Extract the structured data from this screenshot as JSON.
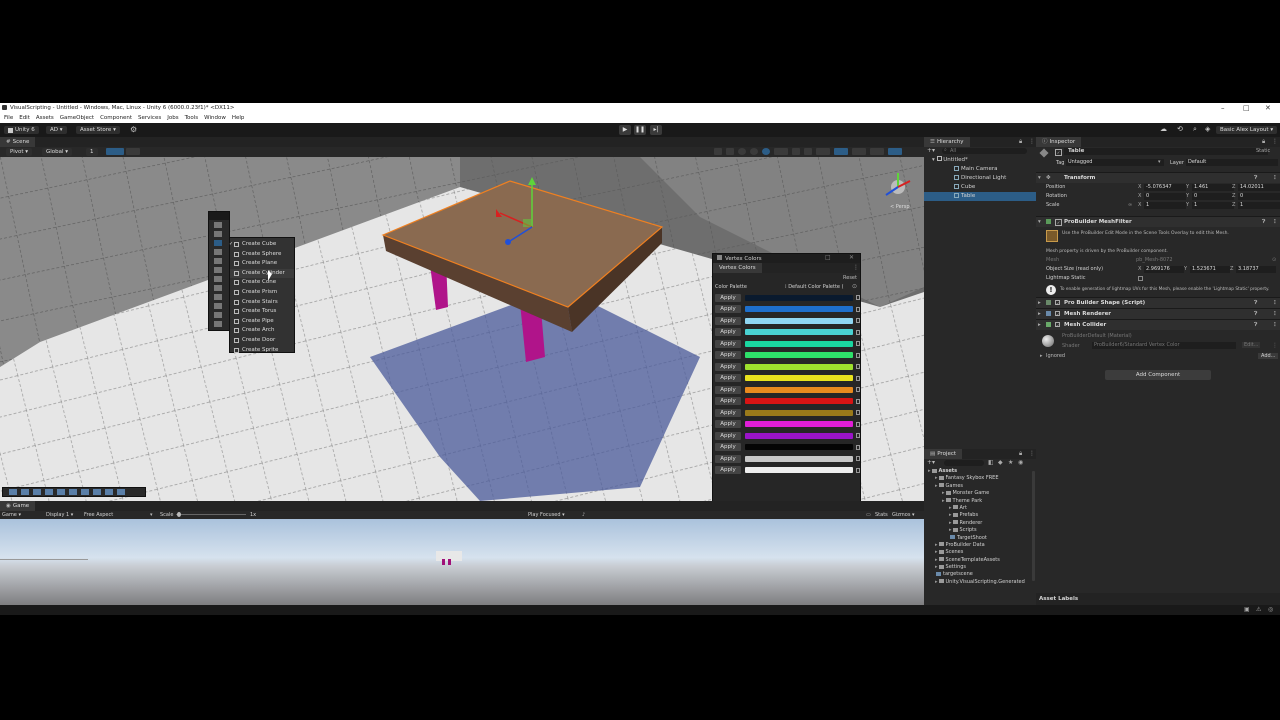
{
  "window": {
    "title": "VisualScripting - Untitled - Windows, Mac, Linux - Unity 6 (6000.0.23f1)* <DX11>",
    "menu": [
      "File",
      "Edit",
      "Assets",
      "GameObject",
      "Component",
      "Services",
      "Jobs",
      "Tools",
      "Window",
      "Help"
    ]
  },
  "toolbar": {
    "account": "Unity 6",
    "ad": "AD",
    "asset_store": "Asset Store",
    "layout": "Basic Alex Layout"
  },
  "scene": {
    "tab": "Scene",
    "pivot": "Pivot",
    "global": "Global",
    "grid_value": "1",
    "gizmo_label": "< Persp"
  },
  "shape_menu": {
    "items": [
      "Create Cube",
      "Create Sphere",
      "Create Plane",
      "Create Cylinder",
      "Create Cone",
      "Create Prism",
      "Create Stairs",
      "Create Torus",
      "Create Pipe",
      "Create Arch",
      "Create Door",
      "Create Sprite"
    ],
    "checked_index": 0
  },
  "vertex_colors": {
    "window_title": "Vertex Colors",
    "tab": "Vertex Colors",
    "reset": "Reset",
    "palette_label": "Color Palette",
    "palette_value": "Default Color Palette (",
    "apply_label": "Apply",
    "colors": [
      "#0a1a2e",
      "#1e6fcc",
      "#8fd6f2",
      "#4ad2d2",
      "#1ad6a0",
      "#2ee06a",
      "#9ee02e",
      "#e8e21e",
      "#e88a1e",
      "#d81414",
      "#9a7a1a",
      "#e01ed8",
      "#9a14c8",
      "#050505",
      "#c8c8c8",
      "#eeeeee"
    ]
  },
  "game": {
    "tab": "Game",
    "mode": "Game",
    "display": "Display 1",
    "aspect": "Free Aspect",
    "scale_label": "Scale",
    "scale_value": "1x",
    "play_focused": "Play Focused",
    "stats": "Stats",
    "gizmos": "Gizmos"
  },
  "hierarchy": {
    "tab": "Hierarchy",
    "search_placeholder": "All",
    "scene": "Untitled*",
    "items": [
      "Main Camera",
      "Directional Light",
      "Cube",
      "Table"
    ],
    "selected": "Table"
  },
  "project": {
    "tab": "Project",
    "tree": [
      {
        "label": "Assets",
        "depth": 0,
        "folder": true
      },
      {
        "label": "Fantasy Skybox FREE",
        "depth": 1,
        "folder": true
      },
      {
        "label": "Games",
        "depth": 1,
        "folder": true
      },
      {
        "label": "Monster Game",
        "depth": 2,
        "folder": true
      },
      {
        "label": "Theme Park",
        "depth": 2,
        "folder": true
      },
      {
        "label": "Art",
        "depth": 3,
        "folder": true
      },
      {
        "label": "Prefabs",
        "depth": 3,
        "folder": true
      },
      {
        "label": "Renderer",
        "depth": 3,
        "folder": true
      },
      {
        "label": "Scripts",
        "depth": 3,
        "folder": true
      },
      {
        "label": "TargetShoot",
        "depth": 3,
        "folder": false
      },
      {
        "label": "ProBuilder Data",
        "depth": 1,
        "folder": true
      },
      {
        "label": "Scenes",
        "depth": 1,
        "folder": true
      },
      {
        "label": "SceneTemplateAssets",
        "depth": 1,
        "folder": true
      },
      {
        "label": "Settings",
        "depth": 1,
        "folder": true
      },
      {
        "label": "targetscene",
        "depth": 1,
        "folder": false
      },
      {
        "label": "Unity.VisualScripting.Generated",
        "depth": 1,
        "folder": true
      }
    ]
  },
  "inspector": {
    "tab": "Inspector",
    "object_name": "Table",
    "static": "Static",
    "tag_label": "Tag",
    "tag_value": "Untagged",
    "layer_label": "Layer",
    "layer_value": "Default",
    "transform": {
      "title": "Transform",
      "position": {
        "label": "Position",
        "x": "-5.076347",
        "y": "1.461",
        "z": "14.02011"
      },
      "rotation": {
        "label": "Rotation",
        "x": "0",
        "y": "0",
        "z": "0"
      },
      "scale": {
        "label": "Scale",
        "x": "1",
        "y": "1",
        "z": "1"
      }
    },
    "meshfilter": {
      "title": "ProBuilder MeshFilter",
      "info": "Use the ProBuilder Edit Mode in the Scene Tools Overlay to edit this Mesh.",
      "driven": "Mesh property is driven by the ProBuilder component.",
      "mesh_label": "Mesh",
      "mesh_value": "pb_Mesh-8072",
      "size_label": "Object Size (read only)",
      "size_x": "2.969176",
      "size_y": "1.523671",
      "size_z": "3.18737",
      "lightmap_label": "Lightmap Static",
      "warning": "To enable generation of lightmap UVs for this Mesh, please enable the 'Lightmap Static' property."
    },
    "components": [
      "Pro Builder Shape (Script)",
      "Mesh Renderer",
      "Mesh Collider"
    ],
    "material": {
      "name": "ProBuilderDefault (Material)",
      "shader_label": "Shader",
      "shader_value": "ProBuilder6/Standard Vertex Color",
      "edit": "Edit...",
      "ignored": "Ignored",
      "add": "Add..."
    },
    "add_component": "Add Component",
    "asset_labels": "Asset Labels"
  },
  "theme": {
    "selection": "#2c5d87",
    "panel": "#282828",
    "accent_orange": "#f08020"
  }
}
